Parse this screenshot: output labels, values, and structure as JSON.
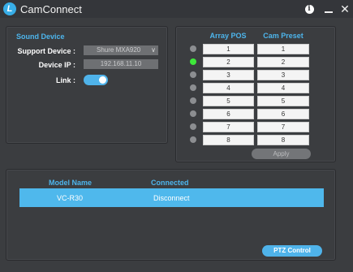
{
  "window": {
    "title": "CamConnect",
    "logo_letter": "L",
    "info_glyph": "i",
    "close_glyph": "✕"
  },
  "sound_device": {
    "section_title": "Sound Device",
    "support_device_label": "Support Device :",
    "support_device_value": "Shure  MXA920",
    "device_ip_label": "Device IP :",
    "device_ip_value": "192.168.11.10",
    "link_label": "Link :",
    "link_enabled": true
  },
  "array": {
    "col_pos": "Array POS",
    "col_cam": "Cam Preset",
    "active_index": 1,
    "rows": [
      {
        "pos": "1",
        "cam": "1"
      },
      {
        "pos": "2",
        "cam": "2"
      },
      {
        "pos": "3",
        "cam": "3"
      },
      {
        "pos": "4",
        "cam": "4"
      },
      {
        "pos": "5",
        "cam": "5"
      },
      {
        "pos": "6",
        "cam": "6"
      },
      {
        "pos": "7",
        "cam": "7"
      },
      {
        "pos": "8",
        "cam": "8"
      }
    ],
    "apply_label": "Apply"
  },
  "camera_list": {
    "col_model": "Model Name",
    "col_connected": "Connected",
    "rows": [
      {
        "model": "VC-R30",
        "connected": "Disconnect"
      }
    ],
    "ptz_label": "PTZ Control"
  },
  "colors": {
    "accent": "#4db5ec",
    "active_led": "#3ee83a",
    "inactive_led": "#8c8e91",
    "background": "#3b3d40"
  }
}
